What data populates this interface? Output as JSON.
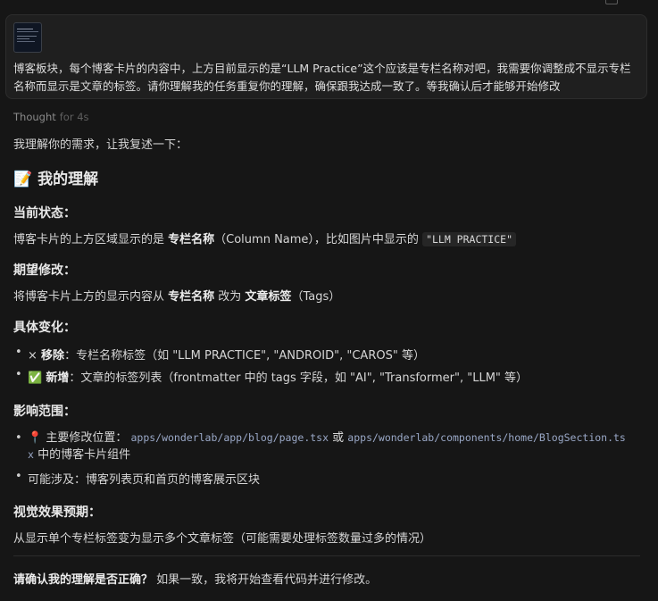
{
  "user_message": {
    "text": "博客板块，每个博客卡片的内容中，上方目前显示的是“LLM Practice”这个应该是专栏名称对吧，我需要你调整成不显示专栏名称而显示是文章的标签。请你理解我的任务重复你的理解，确保跟我达成一致了。等我确认后才能够开始修改"
  },
  "thought": {
    "label": "Thought",
    "duration": "for 4s"
  },
  "reply": {
    "intro": "我理解你的需求，让我复述一下：",
    "heading": "📝 我的理解",
    "current": {
      "title": "当前状态：",
      "pre": "博客卡片的上方区域显示的是 ",
      "bold": "专栏名称",
      "post": "（Column Name），比如图片中显示的 ",
      "code": "\"LLM PRACTICE\""
    },
    "expected": {
      "title": "期望修改：",
      "pre": "将博客卡片上方的显示内容从 ",
      "bold1": "专栏名称",
      "mid": " 改为 ",
      "bold2": "文章标签",
      "post": "（Tags）"
    },
    "changes": {
      "title": "具体变化：",
      "remove_icon": "×",
      "remove_bold": "移除",
      "remove_text": "：专栏名称标签（如 \"LLM PRACTICE\", \"ANDROID\", \"CAROS\" 等）",
      "add_icon": "✅",
      "add_bold": "新增",
      "add_text": "：文章的标签列表（frontmatter 中的 tags 字段，如 \"AI\", \"Transformer\", \"LLM\" 等）"
    },
    "scope": {
      "title": "影响范围：",
      "pin_icon": "📍",
      "item1_pre": " 主要修改位置：",
      "path1": "apps/wonderlab/app/blog/page.tsx",
      "or": " 或 ",
      "path2a": "apps/wonderlab/components/home/BlogSection.ts",
      "path2b": "x",
      "item1_post": " 中的博客卡片组件",
      "item2": "可能涉及：博客列表页和首页的博客展示区块"
    },
    "visual": {
      "title": "视觉效果预期：",
      "text": "从显示单个专栏标签变为显示多个文章标签（可能需要处理标签数量过多的情况）"
    },
    "confirm": {
      "bold": "请确认我的理解是否正确？",
      "text": " 如果一致，我将开始查看代码并进行修改。"
    }
  }
}
